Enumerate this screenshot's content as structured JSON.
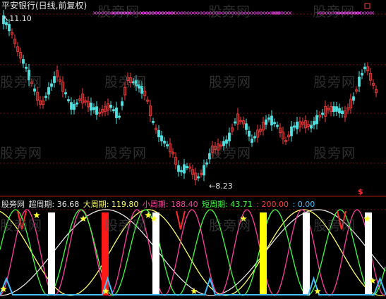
{
  "window": {
    "title": "平安银行(日线,前复权)"
  },
  "price_panel": {
    "high_label": "11.10",
    "low_label": "8.23",
    "signal_mark": "$",
    "colors": {
      "up": "#ff3b3b",
      "down": "#4fe3e3",
      "grid": "#7a1010"
    }
  },
  "indicator_panel": {
    "name": "股旁网",
    "items": [
      {
        "label": "超周期: 36.68",
        "color": "#e6e6e6"
      },
      {
        "label": "大周期: 119.80",
        "color": "#ffff66"
      },
      {
        "label": "小周期: 188.40",
        "color": "#ff3fa0"
      },
      {
        "label": "短周期: 43.71",
        "color": "#3fff3f"
      },
      {
        "label": ": 200.00",
        "color": "#ff3b3b"
      },
      {
        "label": ": 0.00",
        "color": "#3fbfff"
      }
    ]
  },
  "watermark": {
    "text": "股旁网"
  }
}
